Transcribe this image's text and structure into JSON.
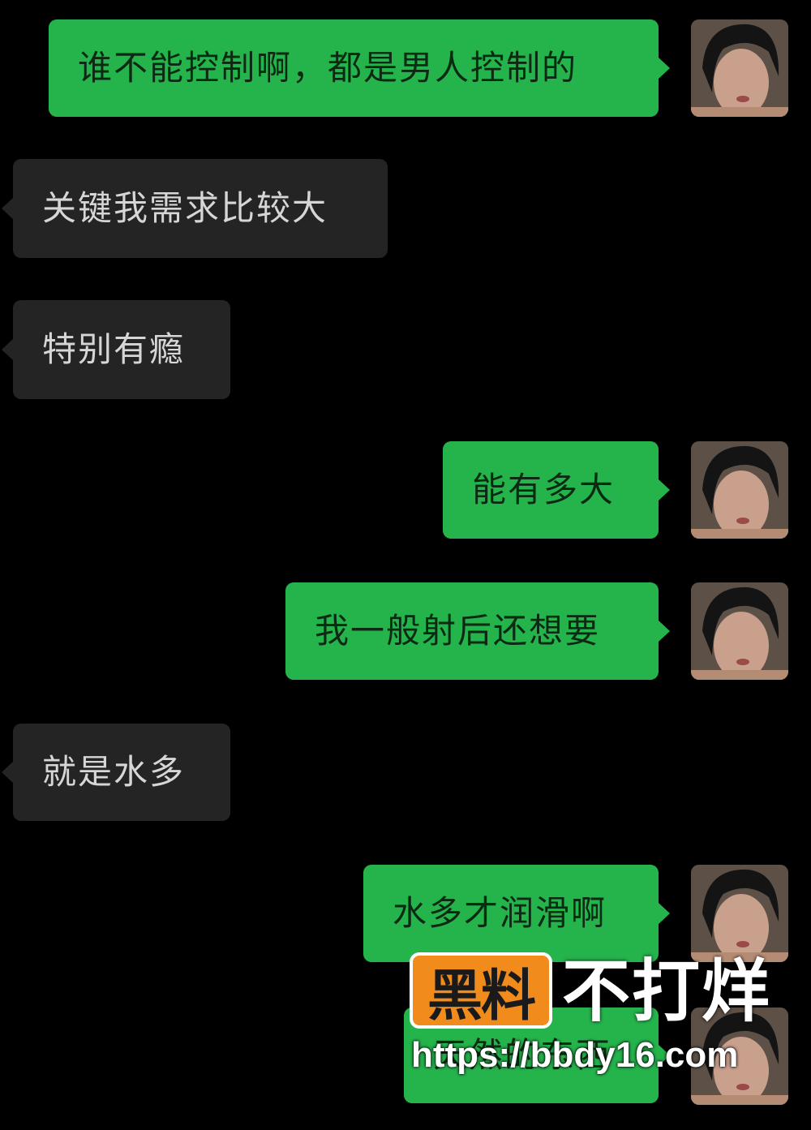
{
  "messages": [
    {
      "side": "out",
      "text": "谁不能控制啊，都是男人控制的"
    },
    {
      "side": "in",
      "text": "关键我需求比较大"
    },
    {
      "side": "in",
      "text": "特别有瘾"
    },
    {
      "side": "out",
      "text": "能有多大"
    },
    {
      "side": "out",
      "text": "我一般射后还想要"
    },
    {
      "side": "in",
      "text": "就是水多"
    },
    {
      "side": "out",
      "text": "水多才润滑啊"
    },
    {
      "side": "out",
      "text": "天然的东西"
    }
  ],
  "watermark": {
    "badge": "黑料",
    "title": "不打烊",
    "url": "https://bbdy16.com"
  },
  "colors": {
    "background": "#000000",
    "outgoing_bubble": "#25b34c",
    "incoming_bubble": "#242424",
    "watermark_badge": "#f08b1c"
  }
}
